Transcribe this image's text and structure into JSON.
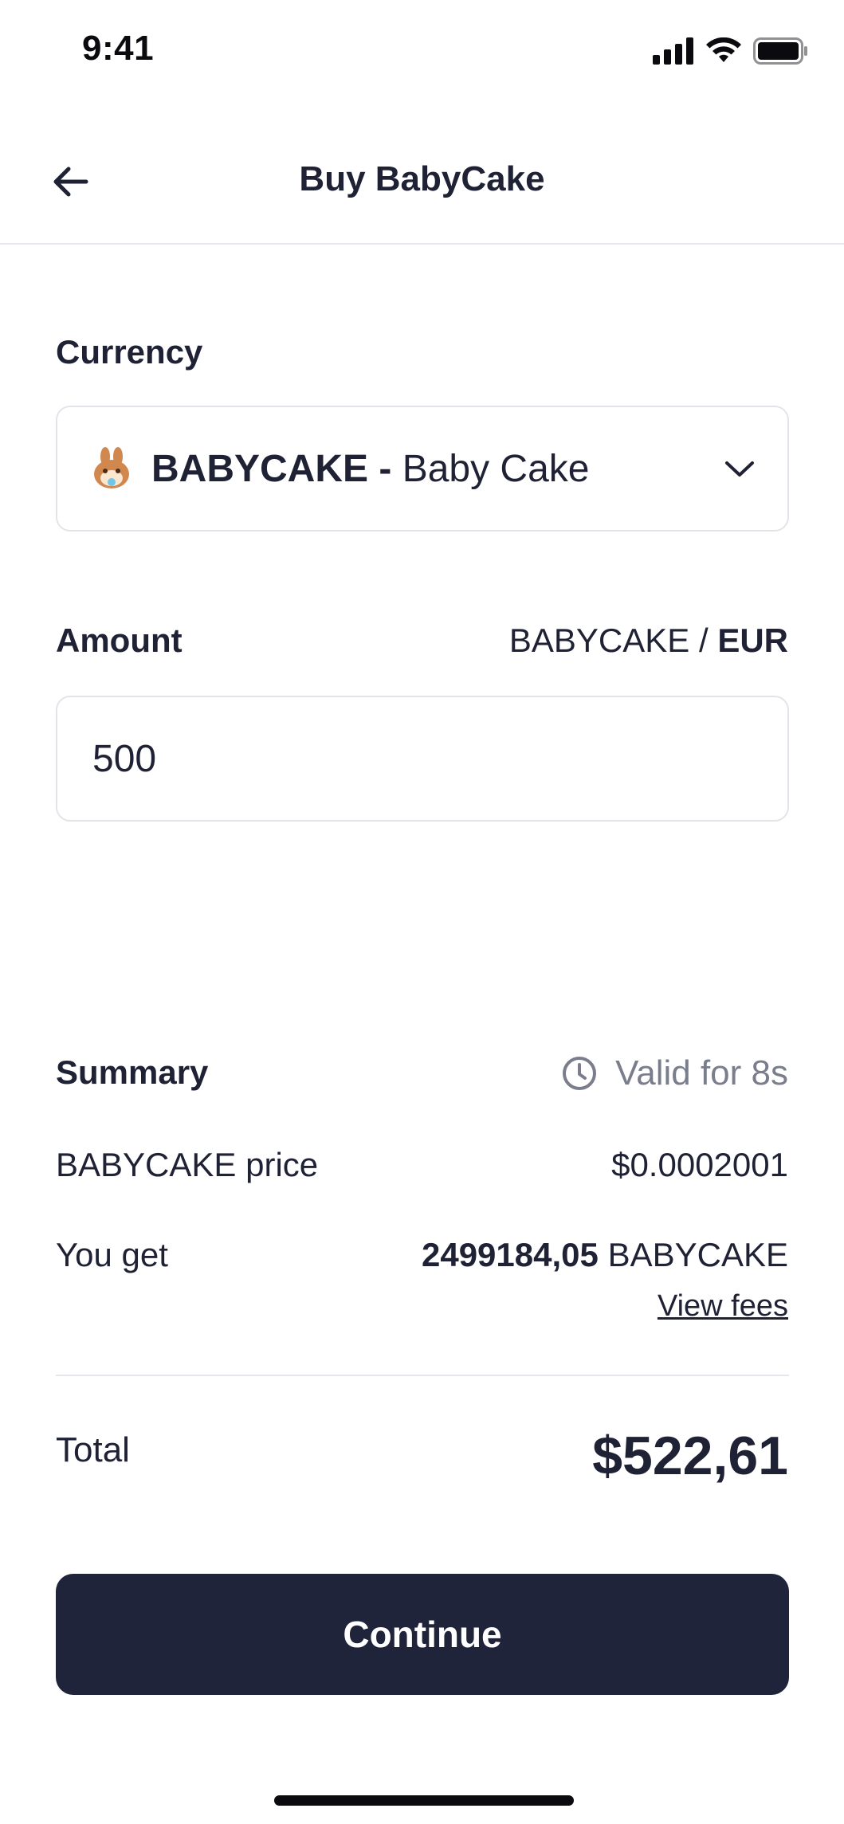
{
  "status_bar": {
    "time": "9:41",
    "icons": [
      "cellular-signal-icon",
      "wifi-icon",
      "battery-icon"
    ]
  },
  "header": {
    "back_icon": "arrow-left-icon",
    "title": "Buy BabyCake"
  },
  "currency": {
    "label": "Currency",
    "selected_symbol": "BABYCAKE -",
    "selected_name": "Baby Cake",
    "coin_icon": "babycake-coin-icon",
    "chevron_icon": "chevron-down-icon"
  },
  "amount": {
    "label": "Amount",
    "unit_primary": "BABYCAKE /",
    "unit_secondary": "EUR",
    "value": "500"
  },
  "summary": {
    "label": "Summary",
    "valid_text": "Valid for 8s",
    "clock_icon": "clock-icon",
    "price_label": "BABYCAKE price",
    "price_value": "$0.0002001",
    "get_label": "You get",
    "get_amount": "2499184,05",
    "get_unit": "BABYCAKE",
    "view_fees": "View fees",
    "total_label": "Total",
    "total_value": "$522,61"
  },
  "cta": {
    "label": "Continue"
  },
  "colors": {
    "primary_dark": "#20243a",
    "text": "#1f2235",
    "muted": "#7a7e8c",
    "border": "#e3e4e9"
  }
}
